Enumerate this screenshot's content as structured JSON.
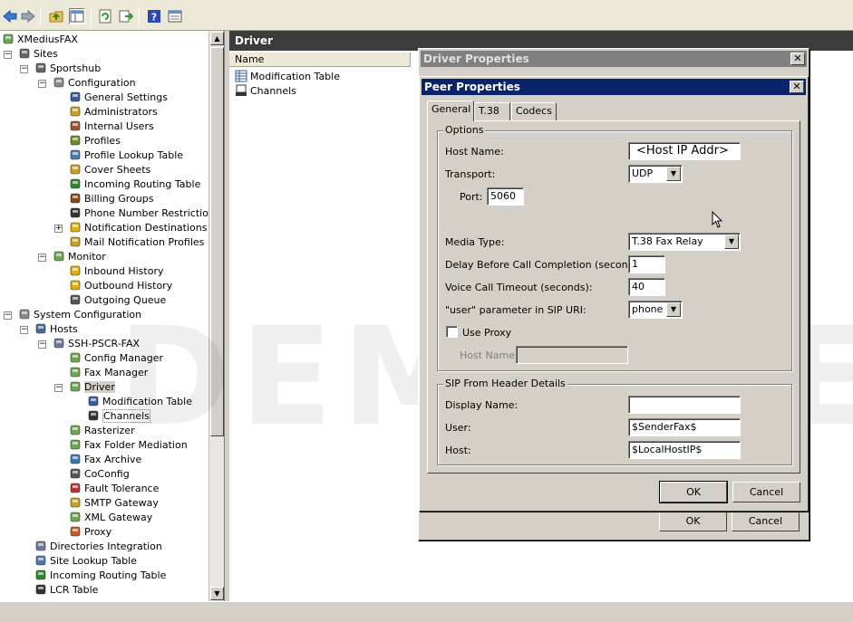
{
  "toolbar": {
    "buttons": [
      "back-icon",
      "forward-icon",
      "up-folder-icon",
      "show-tree-icon",
      "refresh-icon",
      "export-icon",
      "help-icon",
      "properties-icon"
    ]
  },
  "tree": {
    "items": [
      {
        "label": "XMediusFAX",
        "icon": "xmedius-icon"
      },
      {
        "label": "Sites",
        "icon": "sites-icon"
      },
      {
        "label": "Sportshub",
        "icon": "site-icon"
      },
      {
        "label": "Configuration",
        "icon": "gear-icon"
      },
      {
        "label": "General Settings",
        "icon": "settings-icon"
      },
      {
        "label": "Administrators",
        "icon": "administrators-icon"
      },
      {
        "label": "Internal Users",
        "icon": "users-icon"
      },
      {
        "label": "Profiles",
        "icon": "profiles-icon"
      },
      {
        "label": "Profile Lookup Table",
        "icon": "lookup-icon"
      },
      {
        "label": "Cover Sheets",
        "icon": "cover-sheet-icon"
      },
      {
        "label": "Incoming Routing Table",
        "icon": "routing-icon"
      },
      {
        "label": "Billing Groups",
        "icon": "billing-icon"
      },
      {
        "label": "Phone Number Restriction",
        "icon": "phone-restriction-icon"
      },
      {
        "label": "Notification Destinations",
        "icon": "warning-icon"
      },
      {
        "label": "Mail Notification Profiles",
        "icon": "mail-icon"
      },
      {
        "label": "Monitor",
        "icon": "monitor-icon"
      },
      {
        "label": "Inbound History",
        "icon": "inbound-icon"
      },
      {
        "label": "Outbound History",
        "icon": "outbound-icon"
      },
      {
        "label": "Outgoing Queue",
        "icon": "queue-icon"
      },
      {
        "label": "System Configuration",
        "icon": "gear-icon"
      },
      {
        "label": "Hosts",
        "icon": "hosts-icon"
      },
      {
        "label": "SSH-PSCR-FAX",
        "icon": "server-icon"
      },
      {
        "label": "Config Manager",
        "icon": "module-icon"
      },
      {
        "label": "Fax Manager",
        "icon": "fax-manager-icon"
      },
      {
        "label": "Driver",
        "icon": "driver-icon"
      },
      {
        "label": "Modification Table",
        "icon": "table-icon"
      },
      {
        "label": "Channels",
        "icon": "channels-icon"
      },
      {
        "label": "Rasterizer",
        "icon": "rasterizer-icon"
      },
      {
        "label": "Fax Folder Mediation",
        "icon": "module-icon"
      },
      {
        "label": "Fax Archive",
        "icon": "archive-icon"
      },
      {
        "label": "CoConfig",
        "icon": "coconfig-icon"
      },
      {
        "label": "Fault Tolerance",
        "icon": "fault-icon"
      },
      {
        "label": "SMTP Gateway",
        "icon": "smtp-icon"
      },
      {
        "label": "XML Gateway",
        "icon": "xml-icon"
      },
      {
        "label": "Proxy",
        "icon": "proxy-icon"
      },
      {
        "label": "Directories Integration",
        "icon": "directories-icon"
      },
      {
        "label": "Site Lookup Table",
        "icon": "lookup-icon"
      },
      {
        "label": "Incoming Routing Table",
        "icon": "routing-icon"
      },
      {
        "label": "LCR Table",
        "icon": "lcr-icon"
      }
    ]
  },
  "right_pane": {
    "title": "Driver",
    "column_header": "Name",
    "items": [
      {
        "label": "Modification Table",
        "icon": "table-icon"
      },
      {
        "label": "Channels",
        "icon": "channels-icon"
      }
    ]
  },
  "watermark": "DEMO VE",
  "driver_dialog": {
    "title": "Driver Properties",
    "ok_label": "OK",
    "cancel_label": "Cancel"
  },
  "peer_dialog": {
    "title": "Peer Properties",
    "tabs": [
      "General",
      "T.38",
      "Codecs"
    ],
    "active_tab": "General",
    "options_group": "Options",
    "host_name_label": "Host Name:",
    "host_name_value": "<Host IP Addr>",
    "transport_label": "Transport:",
    "transport_value": "UDP",
    "port_label": "Port:",
    "port_value": "5060",
    "media_type_label": "Media Type:",
    "media_type_value": "T.38 Fax Relay",
    "delay_label": "Delay Before Call Completion (seconds):",
    "delay_value": "1",
    "voice_timeout_label": "Voice Call Timeout (seconds):",
    "voice_timeout_value": "40",
    "user_param_label": "\"user\" parameter in SIP URI:",
    "user_param_value": "phone",
    "use_proxy_label": "Use Proxy",
    "use_proxy_checked": false,
    "proxy_host_label": "Host Name:",
    "proxy_host_value": "",
    "sip_group": "SIP From Header Details",
    "display_name_label": "Display Name:",
    "display_name_value": "",
    "user_label": "User:",
    "user_value": "$SenderFax$",
    "host_label": "Host:",
    "host_value": "$LocalHostIP$",
    "ok_label": "OK",
    "cancel_label": "Cancel"
  }
}
